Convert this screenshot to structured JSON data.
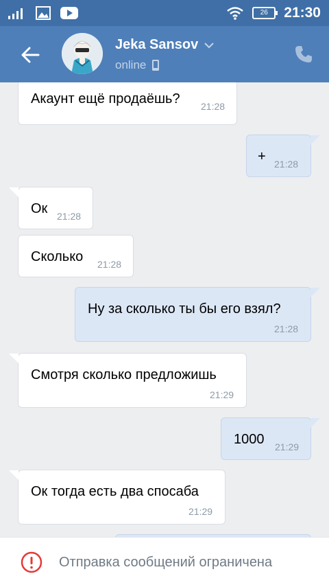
{
  "status_bar": {
    "time": "21:30",
    "battery": "26"
  },
  "header": {
    "contact_name": "Jeka Sansov",
    "presence": "online"
  },
  "messages": [
    {
      "text": "Акаунт  ещё продаёшь?",
      "time": "21:28",
      "direction": "in"
    },
    {
      "text": "+",
      "time": "21:28",
      "direction": "out"
    },
    {
      "text": "Ок",
      "time": "21:28",
      "direction": "in"
    },
    {
      "text": "Сколько",
      "time": "21:28",
      "direction": "in"
    },
    {
      "text": "Ну за сколько ты бы его взял?",
      "time": "21:28",
      "direction": "out"
    },
    {
      "text": "Смотря сколько предложишь",
      "time": "21:29",
      "direction": "in"
    },
    {
      "text": "1000",
      "time": "21:29",
      "direction": "out"
    },
    {
      "text": "Ок тогда есть два спосаба",
      "time": "21:29",
      "direction": "in"
    }
  ],
  "footer": {
    "notice": "Отправка сообщений ограничена"
  },
  "colors": {
    "header": "#4f7fb9",
    "status_bar": "#3f6fa6",
    "incoming_bubble": "#ffffff",
    "outgoing_bubble": "#dce7f6",
    "warning": "#e53935"
  }
}
